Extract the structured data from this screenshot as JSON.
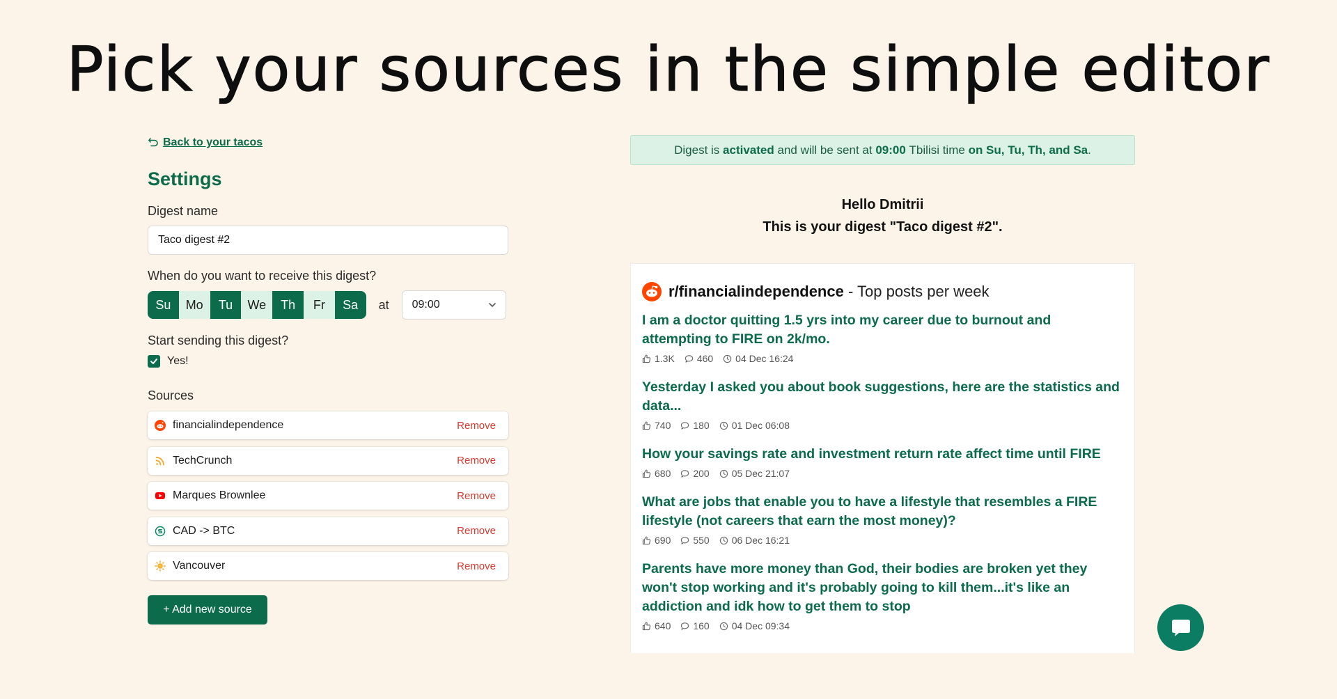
{
  "headline": "Pick your sources in the simple editor",
  "back_link": "Back to your tacos",
  "settings": {
    "title": "Settings",
    "digest_name_label": "Digest name",
    "digest_name_value": "Taco digest #2",
    "when_label": "When do you want to receive this digest?",
    "days": [
      {
        "label": "Su",
        "selected": true
      },
      {
        "label": "Mo",
        "selected": false
      },
      {
        "label": "Tu",
        "selected": true
      },
      {
        "label": "We",
        "selected": false
      },
      {
        "label": "Th",
        "selected": true
      },
      {
        "label": "Fr",
        "selected": false
      },
      {
        "label": "Sa",
        "selected": true
      }
    ],
    "at_label": "at",
    "time_value": "09:00",
    "start_label": "Start sending this digest?",
    "start_checkbox_label": "Yes!",
    "start_checked": true,
    "sources_label": "Sources",
    "sources": [
      {
        "name": "financialindependence",
        "icon": "reddit-icon",
        "remove": "Remove"
      },
      {
        "name": "TechCrunch",
        "icon": "rss-icon",
        "remove": "Remove"
      },
      {
        "name": "Marques Brownlee",
        "icon": "youtube-icon",
        "remove": "Remove"
      },
      {
        "name": "CAD -> BTC",
        "icon": "currency-icon",
        "remove": "Remove"
      },
      {
        "name": "Vancouver",
        "icon": "sun-icon",
        "remove": "Remove"
      }
    ],
    "add_source": "+ Add new source"
  },
  "banner": {
    "p1": "Digest is ",
    "activated": "activated",
    "p2": " and will be sent at ",
    "time": "09:00",
    "p3": " Tbilisi time ",
    "days": "on Su, Tu, Th, and Sa",
    "p4": "."
  },
  "greeting": {
    "line1": "Hello Dmitrii",
    "line2": "This is your digest \"Taco digest #2\"."
  },
  "feed": {
    "subreddit": "r/financialindependence",
    "desc": " - Top posts per week",
    "posts": [
      {
        "title": "I am a doctor quitting 1.5 yrs into my career due to burnout and attempting to FIRE on 2k/mo.",
        "likes": "1.3K",
        "comments": "460",
        "date": "04 Dec 16:24"
      },
      {
        "title": "Yesterday I asked you about book suggestions, here are the statistics and data...",
        "likes": "740",
        "comments": "180",
        "date": "01 Dec 06:08"
      },
      {
        "title": "How your savings rate and investment return rate affect time until FIRE",
        "likes": "680",
        "comments": "200",
        "date": "05 Dec 21:07"
      },
      {
        "title": "What are jobs that enable you to have a lifestyle that resembles a FIRE lifestyle (not careers that earn the most money)?",
        "likes": "690",
        "comments": "550",
        "date": "06 Dec 16:21"
      },
      {
        "title": "Parents have more money than God, their bodies are broken yet they won't stop working and it's probably going to kill them...it's like an addiction and idk how to get them to stop",
        "likes": "640",
        "comments": "160",
        "date": "04 Dec 09:34"
      }
    ]
  },
  "colors": {
    "accent": "#0b6b4b",
    "background": "#fcf4e8",
    "remove": "#d63b2e",
    "chat": "#0b7d63"
  }
}
